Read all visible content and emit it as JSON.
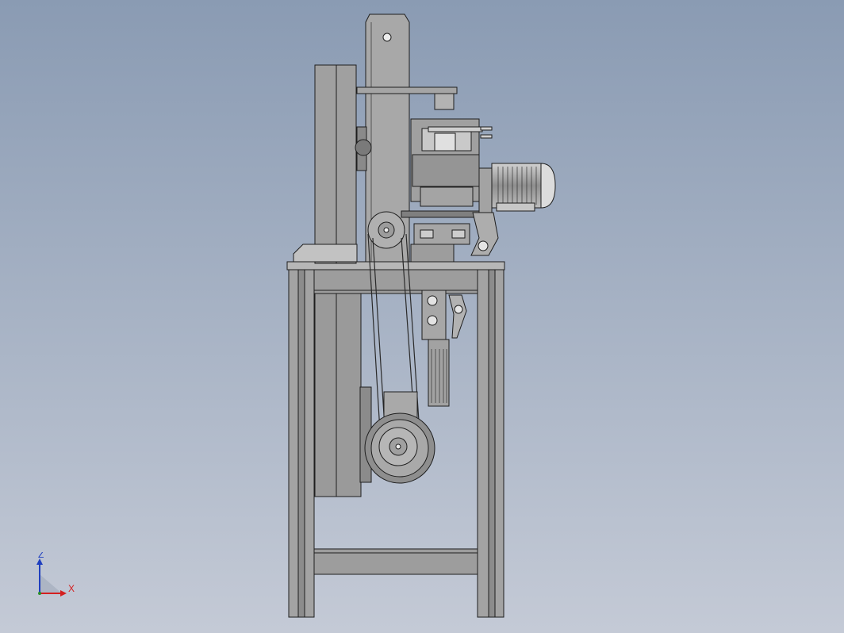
{
  "viewport": {
    "background_top": "#8a9bb3",
    "background_bottom": "#c4cad6",
    "model_fill": "#9a9a9a",
    "model_fill_light": "#b3b3b3",
    "model_fill_dark": "#7d7d7d",
    "edge_color": "#1e1e1e"
  },
  "triad": {
    "z_label": "Z",
    "x_label": "X",
    "z_color": "#1f3fbf",
    "x_color": "#d42020"
  }
}
